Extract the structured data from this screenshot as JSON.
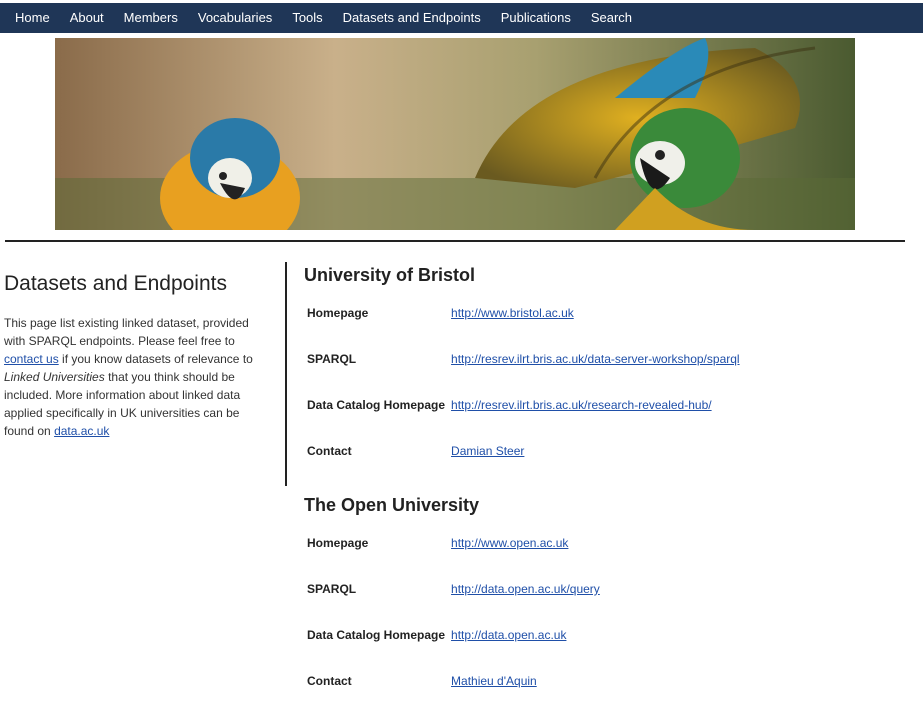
{
  "nav": {
    "items": [
      "Home",
      "About",
      "Members",
      "Vocabularies",
      "Tools",
      "Datasets and Endpoints",
      "Publications",
      "Search"
    ]
  },
  "banner": {
    "image": "macaw-parrots-banner"
  },
  "sidebar": {
    "title": "Datasets and Endpoints",
    "text_1": "This page list existing linked dataset, provided with SPARQL endpoints. Please feel free to",
    "contact_link": "contact us",
    "text_2": " if you know datasets of relevance to",
    "emphasis": "Linked Universities",
    "text_3": "that you think should be included. More information about linked data applied specifically in UK universities can be found on",
    "data_link": "data.ac.uk"
  },
  "organizations": [
    {
      "name": "University of Bristol",
      "rows": [
        {
          "label": "Homepage",
          "value": "http://www.bristol.ac.uk"
        },
        {
          "label": "SPARQL",
          "value": "http://resrev.ilrt.bris.ac.uk/data-server-workshop/sparql"
        },
        {
          "label": "Data Catalog Homepage",
          "value": "http://resrev.ilrt.bris.ac.uk/research-revealed-hub/"
        },
        {
          "label": "Contact",
          "value": "Damian Steer"
        }
      ]
    },
    {
      "name": "The Open University",
      "rows": [
        {
          "label": "Homepage",
          "value": "http://www.open.ac.uk"
        },
        {
          "label": "SPARQL",
          "value": "http://data.open.ac.uk/query"
        },
        {
          "label": "Data Catalog Homepage",
          "value": "http://data.open.ac.uk"
        },
        {
          "label": "Contact",
          "value": "Mathieu d'Aquin"
        }
      ]
    }
  ],
  "colors": {
    "nav_bg": "#1f3657",
    "link": "#1f4fa8"
  }
}
